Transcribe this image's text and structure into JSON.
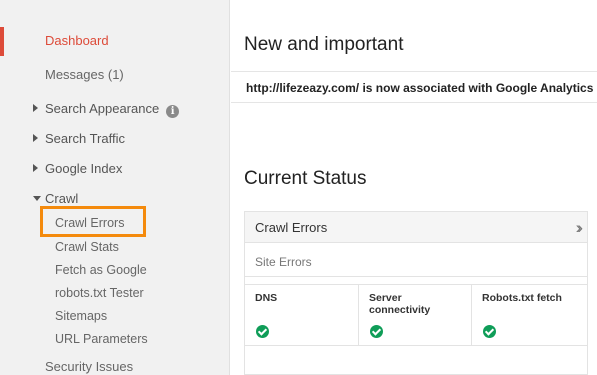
{
  "sidebar": {
    "dashboard": "Dashboard",
    "messages": "Messages (1)",
    "search_appearance": "Search Appearance",
    "search_traffic": "Search Traffic",
    "google_index": "Google Index",
    "crawl": "Crawl",
    "crawl_items": [
      "Crawl Errors",
      "Crawl Stats",
      "Fetch as Google",
      "robots.txt Tester",
      "Sitemaps",
      "URL Parameters"
    ],
    "security_issues": "Security Issues"
  },
  "main": {
    "new_heading": "New and important",
    "notice": "http://lifezeazy.com/ is now associated with Google Analytics",
    "status_heading": "Current Status",
    "card": {
      "title": "Crawl Errors",
      "site_errors": "Site Errors",
      "columns": [
        {
          "label": "DNS",
          "status": "ok"
        },
        {
          "label": "Server connectivity",
          "status": "ok"
        },
        {
          "label": "Robots.txt fetch",
          "status": "ok"
        }
      ]
    }
  },
  "colors": {
    "active": "#dd4b39",
    "highlight": "#f48a0c",
    "success": "#0f9d58"
  },
  "icons": {
    "info": "info-icon",
    "expand": "double-chevron-right-icon",
    "check": "check-circle-icon"
  }
}
